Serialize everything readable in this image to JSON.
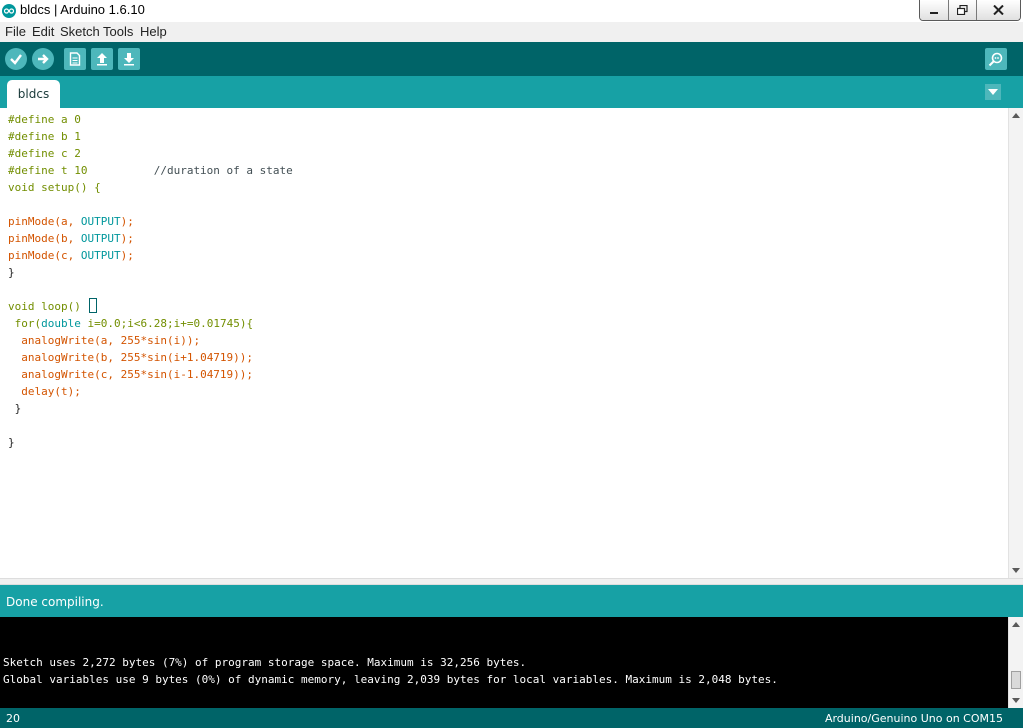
{
  "window": {
    "title": "bldcs | Arduino 1.6.10",
    "logo_icon": "arduino-logo-icon",
    "controls": [
      "minimize-icon",
      "maximize-icon",
      "close-icon"
    ]
  },
  "menu": {
    "items": [
      "File",
      "Edit",
      "Sketch",
      "Tools",
      "Help"
    ]
  },
  "toolbar": {
    "buttons": [
      "verify-icon",
      "upload-icon",
      "new-icon",
      "open-icon",
      "save-icon"
    ],
    "serial_monitor": "serial-monitor-icon"
  },
  "tabs": {
    "items": [
      {
        "label": "bldcs"
      }
    ],
    "menu_icon": "tab-menu-chevron-icon"
  },
  "editor": {
    "lines": [
      "#define a 0",
      "#define b 1",
      "#define c 2",
      "#define t 10          //duration of a state",
      "void setup() {",
      "",
      "pinMode(a, OUTPUT);",
      "pinMode(b, OUTPUT);",
      "pinMode(c, OUTPUT);",
      "}",
      "",
      "void loop() ",
      " for(double i=0.0;i<6.28;i+=0.01745){",
      "  analogWrite(a, 255*sin(i));",
      "  analogWrite(b, 255*sin(i+1.04719));",
      "  analogWrite(c, 255*sin(i-1.04719));",
      "  delay(t);",
      " }",
      "",
      "}"
    ]
  },
  "status": {
    "message": "Done compiling."
  },
  "console": {
    "lines": [
      "Sketch uses 2,272 bytes (7%) of program storage space. Maximum is 32,256 bytes.",
      "Global variables use 9 bytes (0%) of dynamic memory, leaving 2,039 bytes for local variables. Maximum is 2,048 bytes."
    ]
  },
  "footer": {
    "line_number": "20",
    "board": "Arduino/Genuino Uno on COM15"
  },
  "colors": {
    "teal_dark": "#006468",
    "teal": "#17a1a5",
    "button": "#4db7bb",
    "keyword": "#728e00",
    "function": "#d35400",
    "constant": "#00979c"
  }
}
